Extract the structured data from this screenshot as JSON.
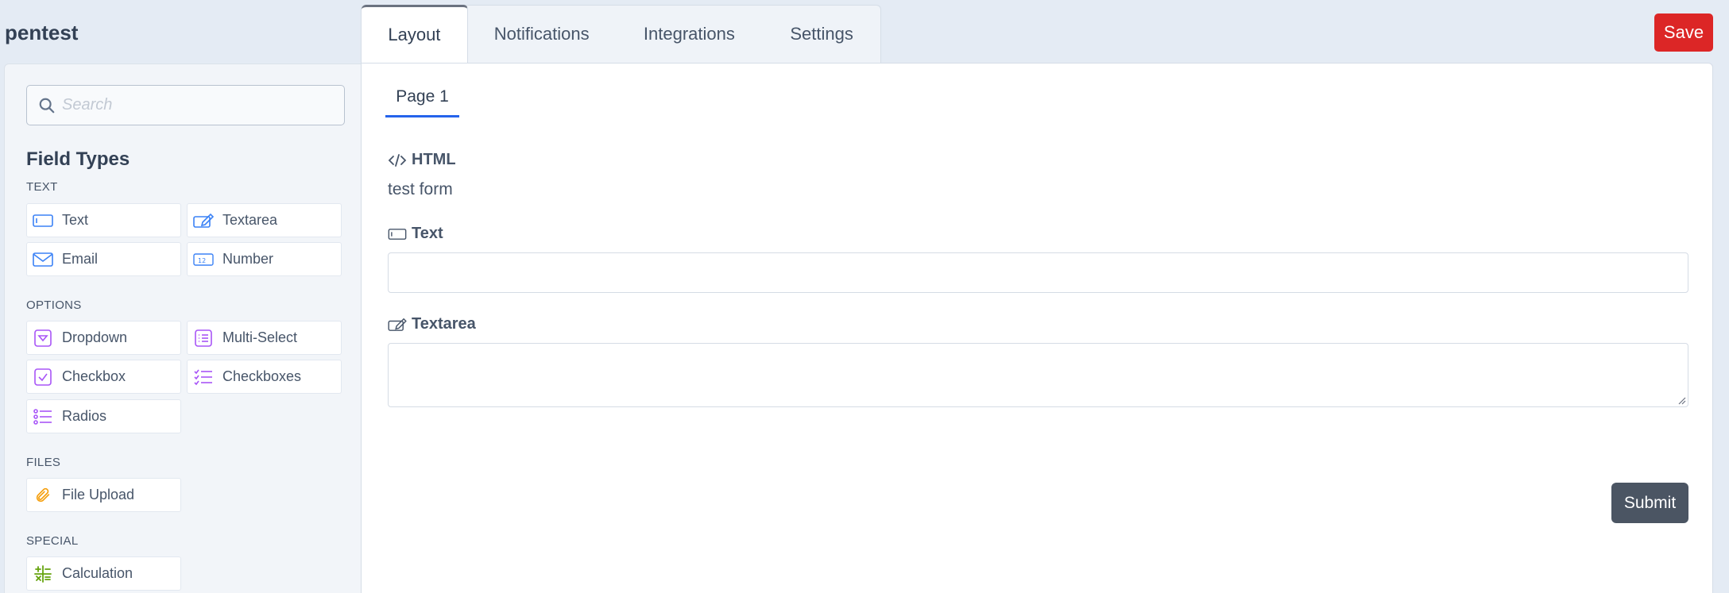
{
  "app": {
    "title": "pentest"
  },
  "toolbar": {
    "save_label": "Save"
  },
  "tabs": [
    {
      "label": "Layout",
      "active": true
    },
    {
      "label": "Notifications",
      "active": false
    },
    {
      "label": "Integrations",
      "active": false
    },
    {
      "label": "Settings",
      "active": false
    }
  ],
  "sidebar": {
    "search": {
      "placeholder": "Search",
      "value": ""
    },
    "heading": "Field Types",
    "groups": [
      {
        "label": "TEXT",
        "items": [
          {
            "label": "Text",
            "icon": "text-field-icon",
            "color": "#3b82f6"
          },
          {
            "label": "Textarea",
            "icon": "textarea-icon",
            "color": "#3b82f6"
          },
          {
            "label": "Email",
            "icon": "envelope-icon",
            "color": "#3b82f6"
          },
          {
            "label": "Number",
            "icon": "number-icon",
            "color": "#3b82f6"
          }
        ]
      },
      {
        "label": "OPTIONS",
        "items": [
          {
            "label": "Dropdown",
            "icon": "dropdown-icon",
            "color": "#a855f7"
          },
          {
            "label": "Multi-Select",
            "icon": "multi-select-icon",
            "color": "#a855f7"
          },
          {
            "label": "Checkbox",
            "icon": "checkbox-icon",
            "color": "#a855f7"
          },
          {
            "label": "Checkboxes",
            "icon": "checklist-icon",
            "color": "#a855f7"
          },
          {
            "label": "Radios",
            "icon": "radio-list-icon",
            "color": "#a855f7"
          }
        ]
      },
      {
        "label": "FILES",
        "items": [
          {
            "label": "File Upload",
            "icon": "paperclip-icon",
            "color": "#f59e0b"
          }
        ]
      },
      {
        "label": "SPECIAL",
        "items": [
          {
            "label": "Calculation",
            "icon": "calculator-icon",
            "color": "#65a30d"
          }
        ]
      }
    ]
  },
  "main": {
    "page_tab": "Page 1",
    "components": {
      "html": {
        "label": "HTML",
        "content": "test form"
      },
      "text": {
        "label": "Text",
        "value": ""
      },
      "textarea": {
        "label": "Textarea",
        "value": ""
      }
    },
    "submit_label": "Submit"
  }
}
